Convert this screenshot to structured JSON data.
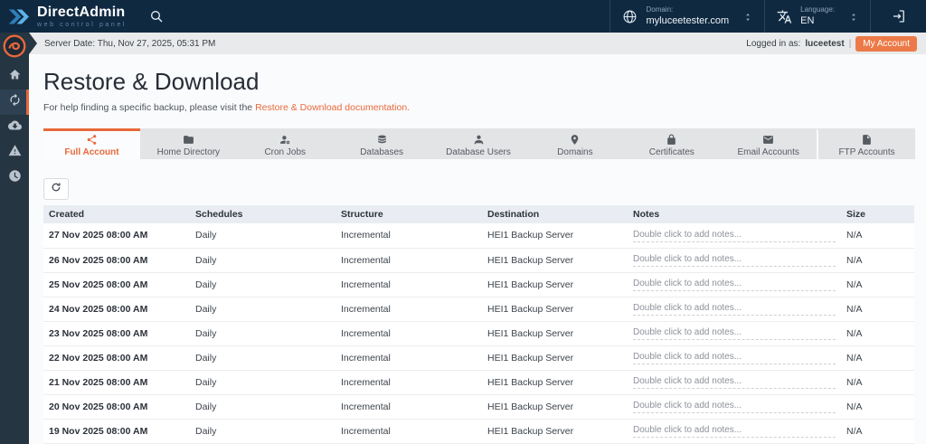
{
  "topbar": {
    "brand_name": "DirectAdmin",
    "brand_tagline": "web control panel",
    "domain": {
      "label": "Domain:",
      "value": "myluceetester.com",
      "icon": "globe-icon"
    },
    "language": {
      "label": "Language:",
      "value": "EN",
      "icon": "translate-icon"
    }
  },
  "serverbar": {
    "server_date": "Server Date: Thu, Nov 27, 2025, 05:31 PM",
    "logged_in_label": "Logged in as:",
    "username": "luceetest",
    "divider": "|",
    "my_account_button": "My Account"
  },
  "page": {
    "title": "Restore & Download",
    "help_prefix": "For help finding a specific backup, please visit the",
    "help_link": "Restore & Download documentation."
  },
  "sidebar": {
    "items": [
      {
        "name": "home",
        "icon": "home-icon",
        "active": false
      },
      {
        "name": "restore",
        "icon": "sync-icon",
        "active": true
      },
      {
        "name": "downloads",
        "icon": "cloud-download-icon",
        "active": false
      },
      {
        "name": "warnings",
        "icon": "warning-icon",
        "active": false
      },
      {
        "name": "history",
        "icon": "clock-icon",
        "active": false
      }
    ]
  },
  "tabs": [
    {
      "label": "Full Account",
      "icon": "share-nodes-icon",
      "active": true
    },
    {
      "label": "Home Directory",
      "icon": "folder-icon",
      "active": false
    },
    {
      "label": "Cron Jobs",
      "icon": "user-gear-icon",
      "active": false
    },
    {
      "label": "Databases",
      "icon": "database-icon",
      "active": false
    },
    {
      "label": "Database Users",
      "icon": "user-icon",
      "active": false
    },
    {
      "label": "Domains",
      "icon": "map-pin-icon",
      "active": false
    },
    {
      "label": "Certificates",
      "icon": "lock-icon",
      "active": false
    },
    {
      "label": "Email Accounts",
      "icon": "envelope-icon",
      "active": false
    },
    {
      "label": "FTP Accounts",
      "icon": "file-icon",
      "active": false,
      "divider_before": true
    }
  ],
  "colors": {
    "accent_orange": "#E8683A",
    "topbar_navy": "#0f2941",
    "sidebar_slate": "#253541",
    "table_header_bg": "#e9edf3",
    "my_account_orange": "#ec7a48"
  },
  "table": {
    "columns": [
      "Created",
      "Schedules",
      "Structure",
      "Destination",
      "Notes",
      "Size"
    ],
    "notes_placeholder": "Double click to add notes...",
    "rows": [
      {
        "created": "27 Nov 2025 08:00 AM",
        "schedules": "Daily",
        "structure": "Incremental",
        "destination": "HEI1 Backup Server",
        "notes": "Double click to add notes...",
        "size": "N/A"
      },
      {
        "created": "26 Nov 2025 08:00 AM",
        "schedules": "Daily",
        "structure": "Incremental",
        "destination": "HEI1 Backup Server",
        "notes": "Double click to add notes...",
        "size": "N/A"
      },
      {
        "created": "25 Nov 2025 08:00 AM",
        "schedules": "Daily",
        "structure": "Incremental",
        "destination": "HEI1 Backup Server",
        "notes": "Double click to add notes...",
        "size": "N/A"
      },
      {
        "created": "24 Nov 2025 08:00 AM",
        "schedules": "Daily",
        "structure": "Incremental",
        "destination": "HEI1 Backup Server",
        "notes": "Double click to add notes...",
        "size": "N/A"
      },
      {
        "created": "23 Nov 2025 08:00 AM",
        "schedules": "Daily",
        "structure": "Incremental",
        "destination": "HEI1 Backup Server",
        "notes": "Double click to add notes...",
        "size": "N/A"
      },
      {
        "created": "22 Nov 2025 08:00 AM",
        "schedules": "Daily",
        "structure": "Incremental",
        "destination": "HEI1 Backup Server",
        "notes": "Double click to add notes...",
        "size": "N/A"
      },
      {
        "created": "21 Nov 2025 08:00 AM",
        "schedules": "Daily",
        "structure": "Incremental",
        "destination": "HEI1 Backup Server",
        "notes": "Double click to add notes...",
        "size": "N/A"
      },
      {
        "created": "20 Nov 2025 08:00 AM",
        "schedules": "Daily",
        "structure": "Incremental",
        "destination": "HEI1 Backup Server",
        "notes": "Double click to add notes...",
        "size": "N/A"
      },
      {
        "created": "19 Nov 2025 08:00 AM",
        "schedules": "Daily",
        "structure": "Incremental",
        "destination": "HEI1 Backup Server",
        "notes": "Double click to add notes...",
        "size": "N/A"
      }
    ]
  }
}
